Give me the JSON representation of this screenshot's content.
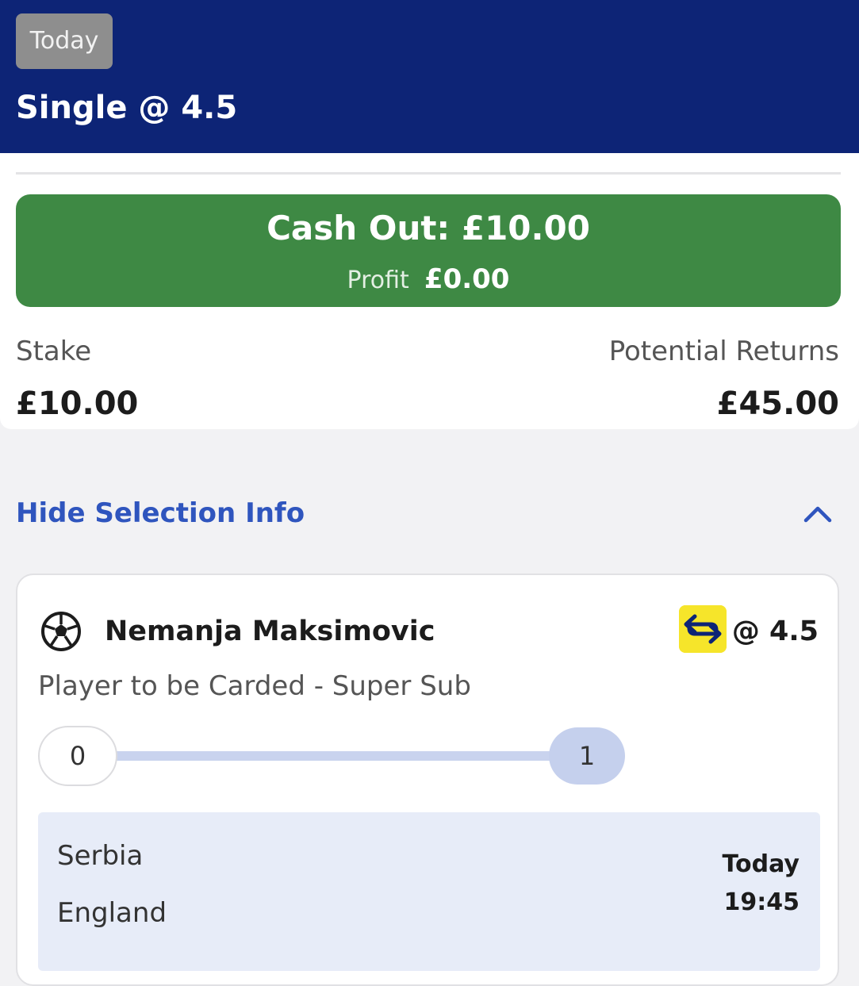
{
  "header": {
    "day_badge": "Today",
    "bet_title": "Single @ 4.5"
  },
  "cash_out": {
    "label": "Cash Out: £10.00",
    "profit_label": "Profit",
    "profit_value": "£0.00"
  },
  "stake": {
    "label": "Stake",
    "value": "£10.00"
  },
  "returns": {
    "label": "Potential Returns",
    "value": "£45.00"
  },
  "toggle": {
    "label": "Hide Selection Info"
  },
  "selection": {
    "sport_icon": "football-icon",
    "player": "Nemanja Maksimovic",
    "badge_icon": "super-sub-swap-icon",
    "odds": "@ 4.5",
    "market": "Player to be Carded - Super Sub",
    "progress": {
      "start": "0",
      "end": "1",
      "fraction": 1.0
    },
    "event": {
      "home": "Serbia",
      "away": "England",
      "date": "Today",
      "time": "19:45"
    }
  },
  "colors": {
    "header_bg": "#0d2476",
    "cashout_green": "#3e8944",
    "link_blue": "#2f55be",
    "super_sub_yellow": "#f6e52a",
    "event_panel_bg": "#e7ecf8"
  }
}
